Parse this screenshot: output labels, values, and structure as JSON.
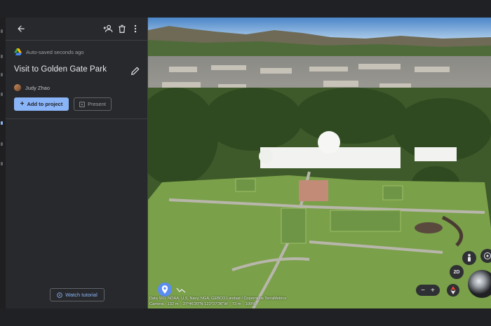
{
  "panel": {
    "autosave_text": "Auto-saved seconds ago",
    "project_title": "Visit to Golden Gate Park",
    "author_name": "Judy Zhao",
    "add_to_project_label": "Add to project",
    "present_label": "Present",
    "watch_tutorial_label": "Watch tutorial"
  },
  "icons": {
    "back": "arrow-back-icon",
    "share": "person-add-icon",
    "delete": "trash-icon",
    "more": "more-vert-icon",
    "edit": "pencil-icon",
    "add": "plus-icon",
    "present": "present-icon",
    "tutorial": "play-circle-icon"
  },
  "map": {
    "attribution": "Data SIO, NOAA, U.S. Navy, NGA, GEBCO Landsat / Copernicus TerraMetrics",
    "camera_label": "Camera : 132 m",
    "coordinates": "37°46'20\"N 122°27'36\"W",
    "altitude": "73 m",
    "zoom": "100%",
    "btn_2d_label": "2D",
    "zoom_out": "−",
    "zoom_in": "+"
  },
  "colors": {
    "accent": "#8ab4f8",
    "panel_bg": "#28292c",
    "app_bg": "#202124"
  }
}
